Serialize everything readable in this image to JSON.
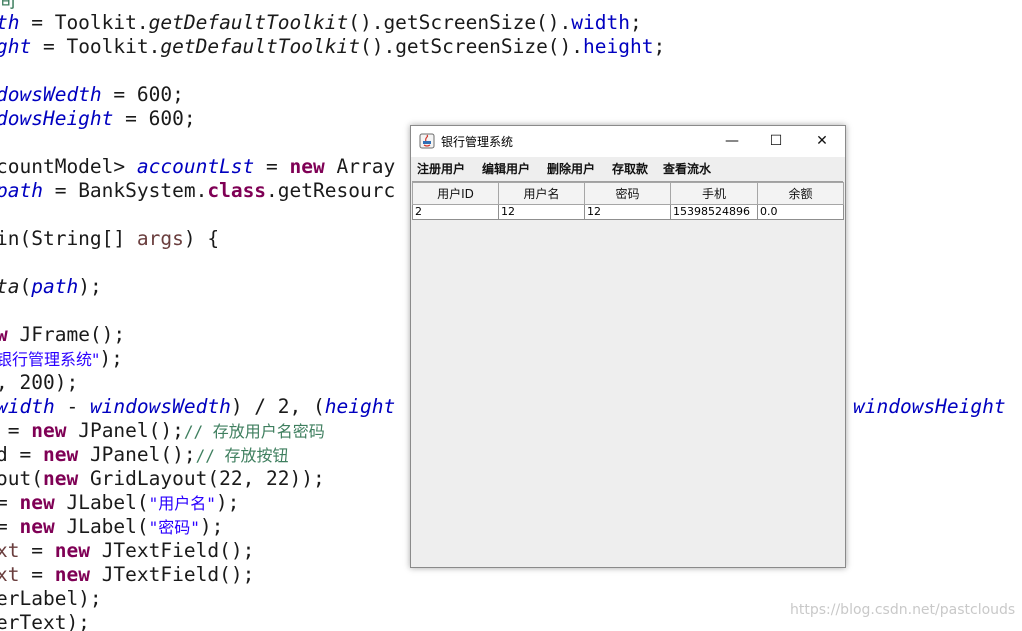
{
  "editor": {
    "lines": {
      "l0": "间",
      "l1a": "th",
      "l1b": " = Toolkit.",
      "l1c": "getDefaultToolkit",
      "l1d": "().getScreenSize().",
      "l1e": "width",
      "l1f": ";",
      "l2a": "ght",
      "l2b": " = Toolkit.",
      "l2c": "getDefaultToolkit",
      "l2d": "().getScreenSize().",
      "l2e": "height",
      "l2f": ";",
      "l4a": "dowsWedth",
      "l4b": " = 600;",
      "l5a": "dowsHeight",
      "l5b": " = 600;",
      "l7a": "countModel> ",
      "l7b": "accountLst",
      "l7c": " = ",
      "l7d": "new",
      "l7e": " Array",
      "l8a": "path",
      "l8b": " = BankSystem.",
      "l8c": "class",
      "l8d": ".getResourc",
      "l10a": "in(String[] ",
      "l10b": "args",
      "l10c": ") {",
      "l12a": "ta",
      "l12b": "(",
      "l12c": "path",
      "l12d": ");",
      "l14a": "w",
      "l14b": " JFrame();",
      "l15a": "银行管理系统\"",
      "l15b": ");",
      "l16a": ", 200);",
      "l17a": "width",
      "l17b": " - ",
      "l17c": "windowsWedth",
      "l17d": ") / 2, (",
      "l17e": "height",
      "l17f": "windowsHeight",
      "l18a": " = ",
      "l18b": "new",
      "l18c": " JPanel();",
      "l18d": "// 存放用户名密码",
      "l19a": "d = ",
      "l19b": "new",
      "l19c": " JPanel();",
      "l19d": "// 存放按钮",
      "l20a": "out(",
      "l20b": "new",
      "l20c": " GridLayout(22, 22));",
      "l21a": "= ",
      "l21b": "new",
      "l21c": " JLabel(",
      "l21d": "\"用户名\"",
      "l21e": ");",
      "l22a": "= ",
      "l22b": "new",
      "l22c": " JLabel(",
      "l22d": "\"密码\"",
      "l22e": ");",
      "l23a": "xt",
      "l23b": " = ",
      "l23c": "new",
      "l23d": " JTextField();",
      "l24a": "xt",
      "l24b": " = ",
      "l24c": "new",
      "l24d": " JTextField();",
      "l25a": "erLabel);",
      "l26a": "erText);"
    }
  },
  "window": {
    "title": "银行管理系统",
    "controls": {
      "minimize": "—",
      "maximize": "☐",
      "close": "✕"
    },
    "menu": [
      "注册用户",
      "编辑用户",
      "删除用户",
      "存取款",
      "查看流水"
    ],
    "table": {
      "headers": [
        "用户ID",
        "用户名",
        "密码",
        "手机",
        "余额"
      ],
      "rows": [
        [
          "2",
          "12",
          "12",
          "15398524896",
          "0.0"
        ]
      ]
    }
  },
  "watermark": "https://blog.csdn.net/pastclouds",
  "colors": {
    "keyword": "#7f0055",
    "field": "#0000c0",
    "string": "#2a00ff",
    "comment": "#3f7f5f"
  }
}
